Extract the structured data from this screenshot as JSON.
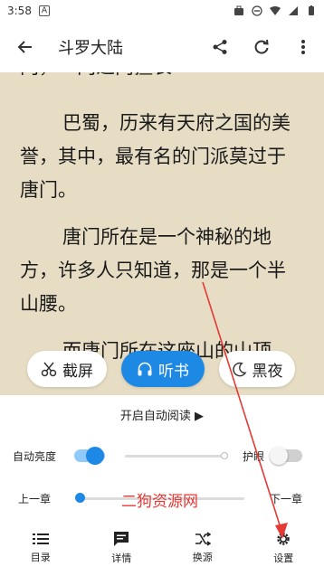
{
  "status_bar": {
    "time": "3:58",
    "badge": "A"
  },
  "toolbar": {
    "title": "斗罗大陆"
  },
  "content": {
    "partial_line": "门，一门之内擅长一",
    "paragraphs": [
      "巴蜀，历来有天府之国的美誉，其中，最有名的门派莫过于唐门。",
      "唐门所在是一个神秘的地方，许多人只知道，那是一个半山腰。",
      "而唐门所在这座山的山顶"
    ]
  },
  "chips": {
    "screenshot": "截屏",
    "listen": "听书",
    "night": "黑夜"
  },
  "panel": {
    "auto_read": "开启自动阅读 ▶",
    "brightness_label": "自动亮度",
    "eye_label": "护眼",
    "prev_chapter": "上一章",
    "next_chapter": "下一章",
    "watermark": "二狗资源网"
  },
  "nav": {
    "catalog": "目录",
    "detail": "详情",
    "source": "换源",
    "settings": "设置"
  },
  "colors": {
    "accent": "#1E88E5",
    "paper": "#E6DDC4",
    "annotation": "#E53935"
  }
}
